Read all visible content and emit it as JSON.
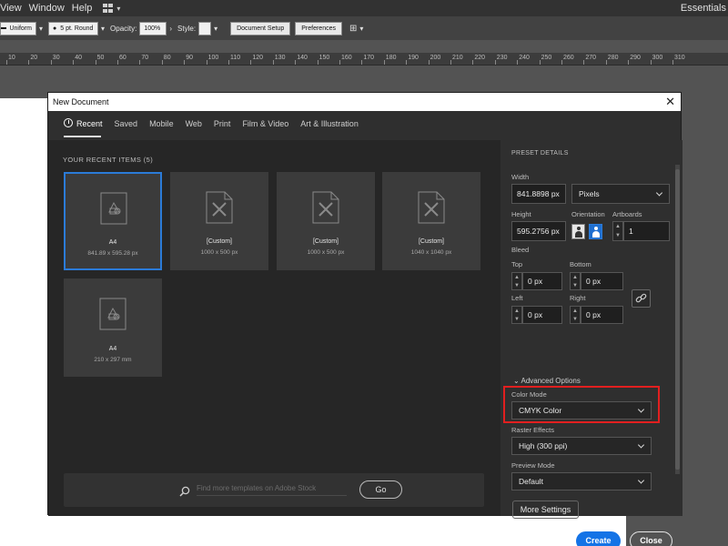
{
  "menubar": {
    "items": [
      "View",
      "Window",
      "Help"
    ],
    "workspace": "Essentials"
  },
  "ctrlbar": {
    "stroke_style": "Uniform",
    "brush": "5 pt. Round",
    "opacity_label": "Opacity:",
    "opacity_value": "100%",
    "style_label": "Style:",
    "doc_setup": "Document Setup",
    "preferences": "Preferences"
  },
  "ruler": {
    "ticks": [
      "10",
      "20",
      "30",
      "40",
      "50",
      "60",
      "70",
      "80",
      "90",
      "100",
      "110",
      "120",
      "130",
      "140",
      "150",
      "160",
      "170",
      "180",
      "190",
      "200",
      "210",
      "220",
      "230",
      "240",
      "250",
      "260",
      "270",
      "280",
      "290",
      "300",
      "310"
    ]
  },
  "dialog": {
    "title": "New Document",
    "tabs": [
      "Recent",
      "Saved",
      "Mobile",
      "Web",
      "Print",
      "Film & Video",
      "Art & Illustration"
    ],
    "recent_header": "YOUR RECENT ITEMS  (5)",
    "cards": [
      {
        "name": "A4",
        "size": "841.89 x 595.28 px"
      },
      {
        "name": "[Custom]",
        "size": "1000 x 500 px"
      },
      {
        "name": "[Custom]",
        "size": "1000 x 500 px"
      },
      {
        "name": "[Custom]",
        "size": "1040 x 1040 px"
      },
      {
        "name": "A4",
        "size": "210 x 297 mm"
      }
    ],
    "search_placeholder": "Find more templates on Adobe Stock",
    "go_label": "Go"
  },
  "preset": {
    "header": "PRESET DETAILS",
    "width_label": "Width",
    "width_value": "841.8898 px",
    "units": "Pixels",
    "height_label": "Height",
    "height_value": "595.2756 px",
    "orientation_label": "Orientation",
    "artboards_label": "Artboards",
    "artboards_value": "1",
    "bleed_label": "Bleed",
    "top_label": "Top",
    "top_value": "0 px",
    "bottom_label": "Bottom",
    "bottom_value": "0 px",
    "left_label": "Left",
    "left_value": "0 px",
    "right_label": "Right",
    "right_value": "0 px",
    "advanced_label": "Advanced Options",
    "color_mode_label": "Color Mode",
    "color_mode_value": "CMYK Color",
    "raster_label": "Raster Effects",
    "raster_value": "High (300 ppi)",
    "preview_label": "Preview Mode",
    "preview_value": "Default",
    "more_settings": "More Settings",
    "create": "Create",
    "close": "Close"
  },
  "colors": {
    "accent": "#1473e6",
    "selected_border": "#2b7bd8",
    "highlight": "#e21f1f"
  }
}
